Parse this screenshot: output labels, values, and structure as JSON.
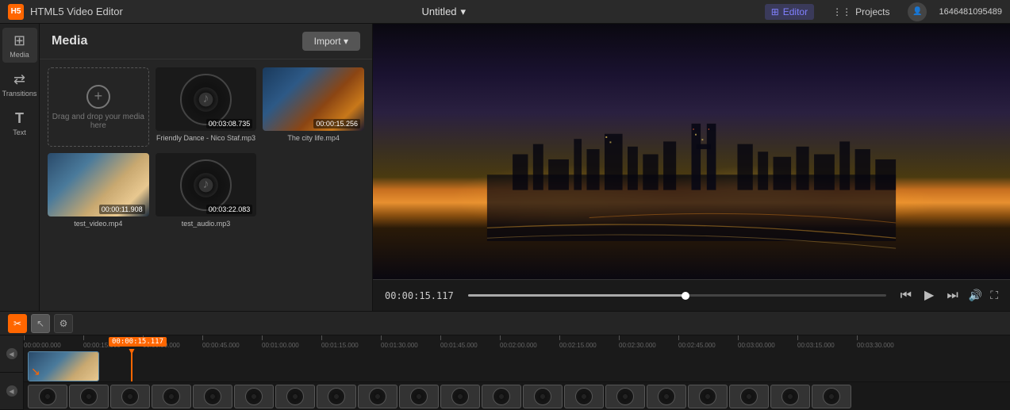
{
  "app": {
    "title": "HTML5 Video Editor",
    "icon": "H5"
  },
  "topbar": {
    "title": "Untitled",
    "editor_label": "Editor",
    "projects_label": "Projects",
    "user_id": "1646481095489"
  },
  "sidebar": {
    "items": [
      {
        "label": "Media",
        "icon": "⊞",
        "active": true
      },
      {
        "label": "Transitions",
        "icon": "⇄",
        "active": false
      },
      {
        "label": "Text",
        "icon": "T",
        "active": false
      }
    ]
  },
  "media": {
    "title": "Media",
    "import_label": "Import ▾",
    "drop_text": "Drag and drop your media here",
    "items": [
      {
        "name": "Friendly Dance - Nico Staf.mp3",
        "duration": "00:03:08.735",
        "type": "audio"
      },
      {
        "name": "The city life.mp4",
        "duration": "00:00:15.256",
        "type": "video"
      },
      {
        "name": "test_video.mp4",
        "duration": "00:00:11.908",
        "type": "video"
      },
      {
        "name": "test_audio.mp3",
        "duration": "00:03:22.083",
        "type": "audio"
      }
    ]
  },
  "preview": {
    "timecode": "00:00:15.117",
    "volume_icon": "🔊",
    "fullscreen_icon": "⛶"
  },
  "timeline": {
    "toolbar": {
      "cut_icon": "✂",
      "cursor_icon": "↖",
      "settings_icon": "⚙"
    },
    "playhead_label": "00:00:15.117",
    "ruler_marks": [
      "00:00:00.000",
      "00:00:15.000",
      "00:00:30.000",
      "00:00:45.000",
      "00:01:00.000",
      "00:01:15.000",
      "00:01:30.000",
      "00:01:45.000",
      "00:02:00.000",
      "00:02:15.000",
      "00:02:30.000",
      "00:02:45.000",
      "00:03:00.000",
      "00:03:15.000",
      "00:03:30.000"
    ]
  }
}
